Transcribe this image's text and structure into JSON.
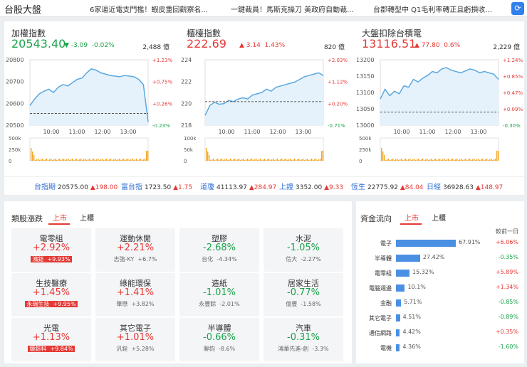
{
  "header": {
    "title": "台股大盤",
    "news": [
      "6家逼近電支門檻！蝦皮重回觀察名...",
      "一鍵裁員！馬斯克操刀 美政府自動裁...",
      "台郡轉型中 Q1毛利率轉正且虧損收..."
    ],
    "refresh_icon": "refresh-icon"
  },
  "indices": [
    {
      "name": "加權指數",
      "value": "20543.40",
      "change": "-3.09",
      "change_pct": "-0.02%",
      "direction": "down",
      "volume": "2,488 億",
      "yticks_left": [
        "20800",
        "20700",
        "20600",
        "20500"
      ],
      "yticks_right": [
        "+1.23%",
        "+0.75%",
        "+0.26%",
        "-0.23%"
      ],
      "xticks": [
        "10:00",
        "11:00",
        "12:00",
        "13:00"
      ],
      "vol_ticks": [
        "500k",
        "250k",
        "0"
      ]
    },
    {
      "name": "櫃檯指數",
      "value": "222.69",
      "change": "3.14",
      "change_pct": "1.43%",
      "direction": "up",
      "volume": "820 億",
      "yticks_left": [
        "224",
        "222",
        "220",
        "218"
      ],
      "yticks_right": [
        "+2.03%",
        "+1.12%",
        "+0.20%",
        "-0.71%"
      ],
      "xticks": [
        "10:00",
        "11:00",
        "12:00",
        "13:00"
      ],
      "vol_ticks": [
        "100k",
        "50k",
        "0"
      ]
    },
    {
      "name": "大盤扣除台積電",
      "value": "13116.51",
      "change": "77.80",
      "change_pct": "0.6%",
      "direction": "up",
      "volume": "2,229 億",
      "yticks_left": [
        "13200",
        "13150",
        "13100",
        "13050",
        "13000"
      ],
      "yticks_right": [
        "+1.24%",
        "+0.85%",
        "+0.47%",
        "+0.09%",
        "-0.30%"
      ],
      "xticks": [
        "10:00",
        "11:00",
        "12:00",
        "13:00"
      ],
      "vol_ticks": [
        "500k",
        "250k",
        "0"
      ]
    }
  ],
  "tickers": [
    {
      "name": "台指期",
      "value": "20575.00",
      "change": "▲198.00"
    },
    {
      "name": "富台指",
      "value": "1723.50",
      "change": "▲1.75"
    },
    {
      "name": "道瓊",
      "value": "41113.97",
      "change": "▲284.97"
    },
    {
      "name": "上證",
      "value": "3352.00",
      "change": "▲9.33"
    },
    {
      "name": "恆生",
      "value": "22775.92",
      "change": "▲84.04"
    },
    {
      "name": "日經",
      "value": "36928.63",
      "change": "▲148.97"
    }
  ],
  "sectors": {
    "title": "類股漲跌",
    "tabs": [
      "上市",
      "上櫃"
    ],
    "items": [
      {
        "name": "電零組",
        "pct": "+2.92%",
        "dir": "up",
        "stock": "鴻鈺",
        "stock_chg": "+9.93%",
        "highlight": true
      },
      {
        "name": "運動休閒",
        "pct": "+2.21%",
        "dir": "up",
        "stock": "志強-KY",
        "stock_chg": "+6.7%",
        "highlight": false
      },
      {
        "name": "塑膠",
        "pct": "-2.68%",
        "dir": "down",
        "stock": "台化",
        "stock_chg": "-4.34%",
        "highlight": false
      },
      {
        "name": "水泥",
        "pct": "-1.05%",
        "dir": "down",
        "stock": "信大",
        "stock_chg": "-2.27%",
        "highlight": false
      },
      {
        "name": "生技醫療",
        "pct": "+1.45%",
        "dir": "up",
        "stock": "永瑞生技",
        "stock_chg": "+9.95%",
        "highlight": true
      },
      {
        "name": "綠能環保",
        "pct": "+1.41%",
        "dir": "up",
        "stock": "華懋",
        "stock_chg": "+3.82%",
        "highlight": false
      },
      {
        "name": "造紙",
        "pct": "-1.01%",
        "dir": "down",
        "stock": "永豐餘",
        "stock_chg": "-2.01%",
        "highlight": false
      },
      {
        "name": "居家生活",
        "pct": "-0.77%",
        "dir": "down",
        "stock": "億豐",
        "stock_chg": "-1.58%",
        "highlight": false
      },
      {
        "name": "光電",
        "pct": "+1.13%",
        "dir": "up",
        "stock": "鏡鈺科",
        "stock_chg": "+9.84%",
        "highlight": true
      },
      {
        "name": "其它電子",
        "pct": "+1.01%",
        "dir": "up",
        "stock": "汎銓",
        "stock_chg": "+5.28%",
        "highlight": false
      },
      {
        "name": "半導體",
        "pct": "-0.66%",
        "dir": "down",
        "stock": "聯鈞",
        "stock_chg": "-8.6%",
        "highlight": false
      },
      {
        "name": "汽車",
        "pct": "-0.31%",
        "dir": "down",
        "stock": "鴻華先進-創",
        "stock_chg": "-3.3%",
        "highlight": false
      }
    ]
  },
  "flow": {
    "title": "資金流向",
    "tabs": [
      "上市",
      "上櫃"
    ],
    "compare_label": "較前一日",
    "items": [
      {
        "name": "電子",
        "pct": "67.91%",
        "share": 67.91,
        "chg": "+6.06%",
        "dir": "up"
      },
      {
        "name": "半導體",
        "pct": "27.42%",
        "share": 27.42,
        "chg": "-0.35%",
        "dir": "down"
      },
      {
        "name": "電零組",
        "pct": "15.32%",
        "share": 15.32,
        "chg": "+5.89%",
        "dir": "up"
      },
      {
        "name": "電腦週邊",
        "pct": "10.1%",
        "share": 10.1,
        "chg": "+1.34%",
        "dir": "up"
      },
      {
        "name": "金融",
        "pct": "5.71%",
        "share": 5.71,
        "chg": "-0.85%",
        "dir": "down"
      },
      {
        "name": "其它電子",
        "pct": "4.51%",
        "share": 4.51,
        "chg": "-0.89%",
        "dir": "down"
      },
      {
        "name": "通信網路",
        "pct": "4.42%",
        "share": 4.42,
        "chg": "+0.35%",
        "dir": "up"
      },
      {
        "name": "電機",
        "pct": "4.36%",
        "share": 4.36,
        "chg": "-1.60%",
        "dir": "down"
      }
    ]
  },
  "colors": {
    "up": "#e53935",
    "down": "#1aa34a",
    "line": "#5aa8e0",
    "bar": "#4a90e2",
    "vol": "#f5a623"
  }
}
